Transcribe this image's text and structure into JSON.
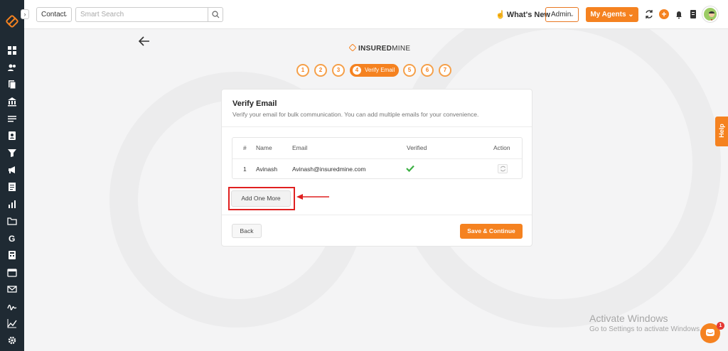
{
  "sidebar": {
    "icons": [
      "dashboard-icon",
      "users-icon",
      "documents-icon",
      "bank-icon",
      "list-icon",
      "contact-card-icon",
      "funnel-icon",
      "megaphone-icon",
      "reports-icon",
      "analytics-icon",
      "folder-icon",
      "google-icon",
      "calculator-icon",
      "calendar-icon",
      "mail-icon",
      "signature-icon",
      "chart-line-icon",
      "settings-icon"
    ]
  },
  "header": {
    "contact_select": "Contact",
    "search_placeholder": "Smart Search",
    "whats_new": "What's New",
    "admin_select": "Admin",
    "my_agents": "My Agents"
  },
  "brand": {
    "bold": "INSURED",
    "light": "MINE"
  },
  "steps": {
    "items": [
      "1",
      "2",
      "3",
      "5",
      "6",
      "7"
    ],
    "active_number": "4",
    "active_label": "Verify Email"
  },
  "card": {
    "title": "Verify Email",
    "subtitle": "Verify your email for bulk communication. You can add multiple emails for your convenience.",
    "table": {
      "headers": [
        "#",
        "Name",
        "Email",
        "Verified",
        "Action"
      ],
      "rows": [
        {
          "index": "1",
          "name": "Avinash",
          "email": "Avinash@insuredmine.com",
          "verified": true
        }
      ]
    },
    "add_button": "Add One More",
    "back_button": "Back",
    "save_button": "Save & Continue"
  },
  "help_tab": "Help",
  "windows": {
    "title": "Activate Windows",
    "subtitle": "Go to Settings to activate Windows."
  },
  "chat_badge": "1",
  "colors": {
    "accent": "#f58220",
    "sidebar": "#1f2a33",
    "highlight": "#e02020",
    "success": "#3cb043"
  }
}
